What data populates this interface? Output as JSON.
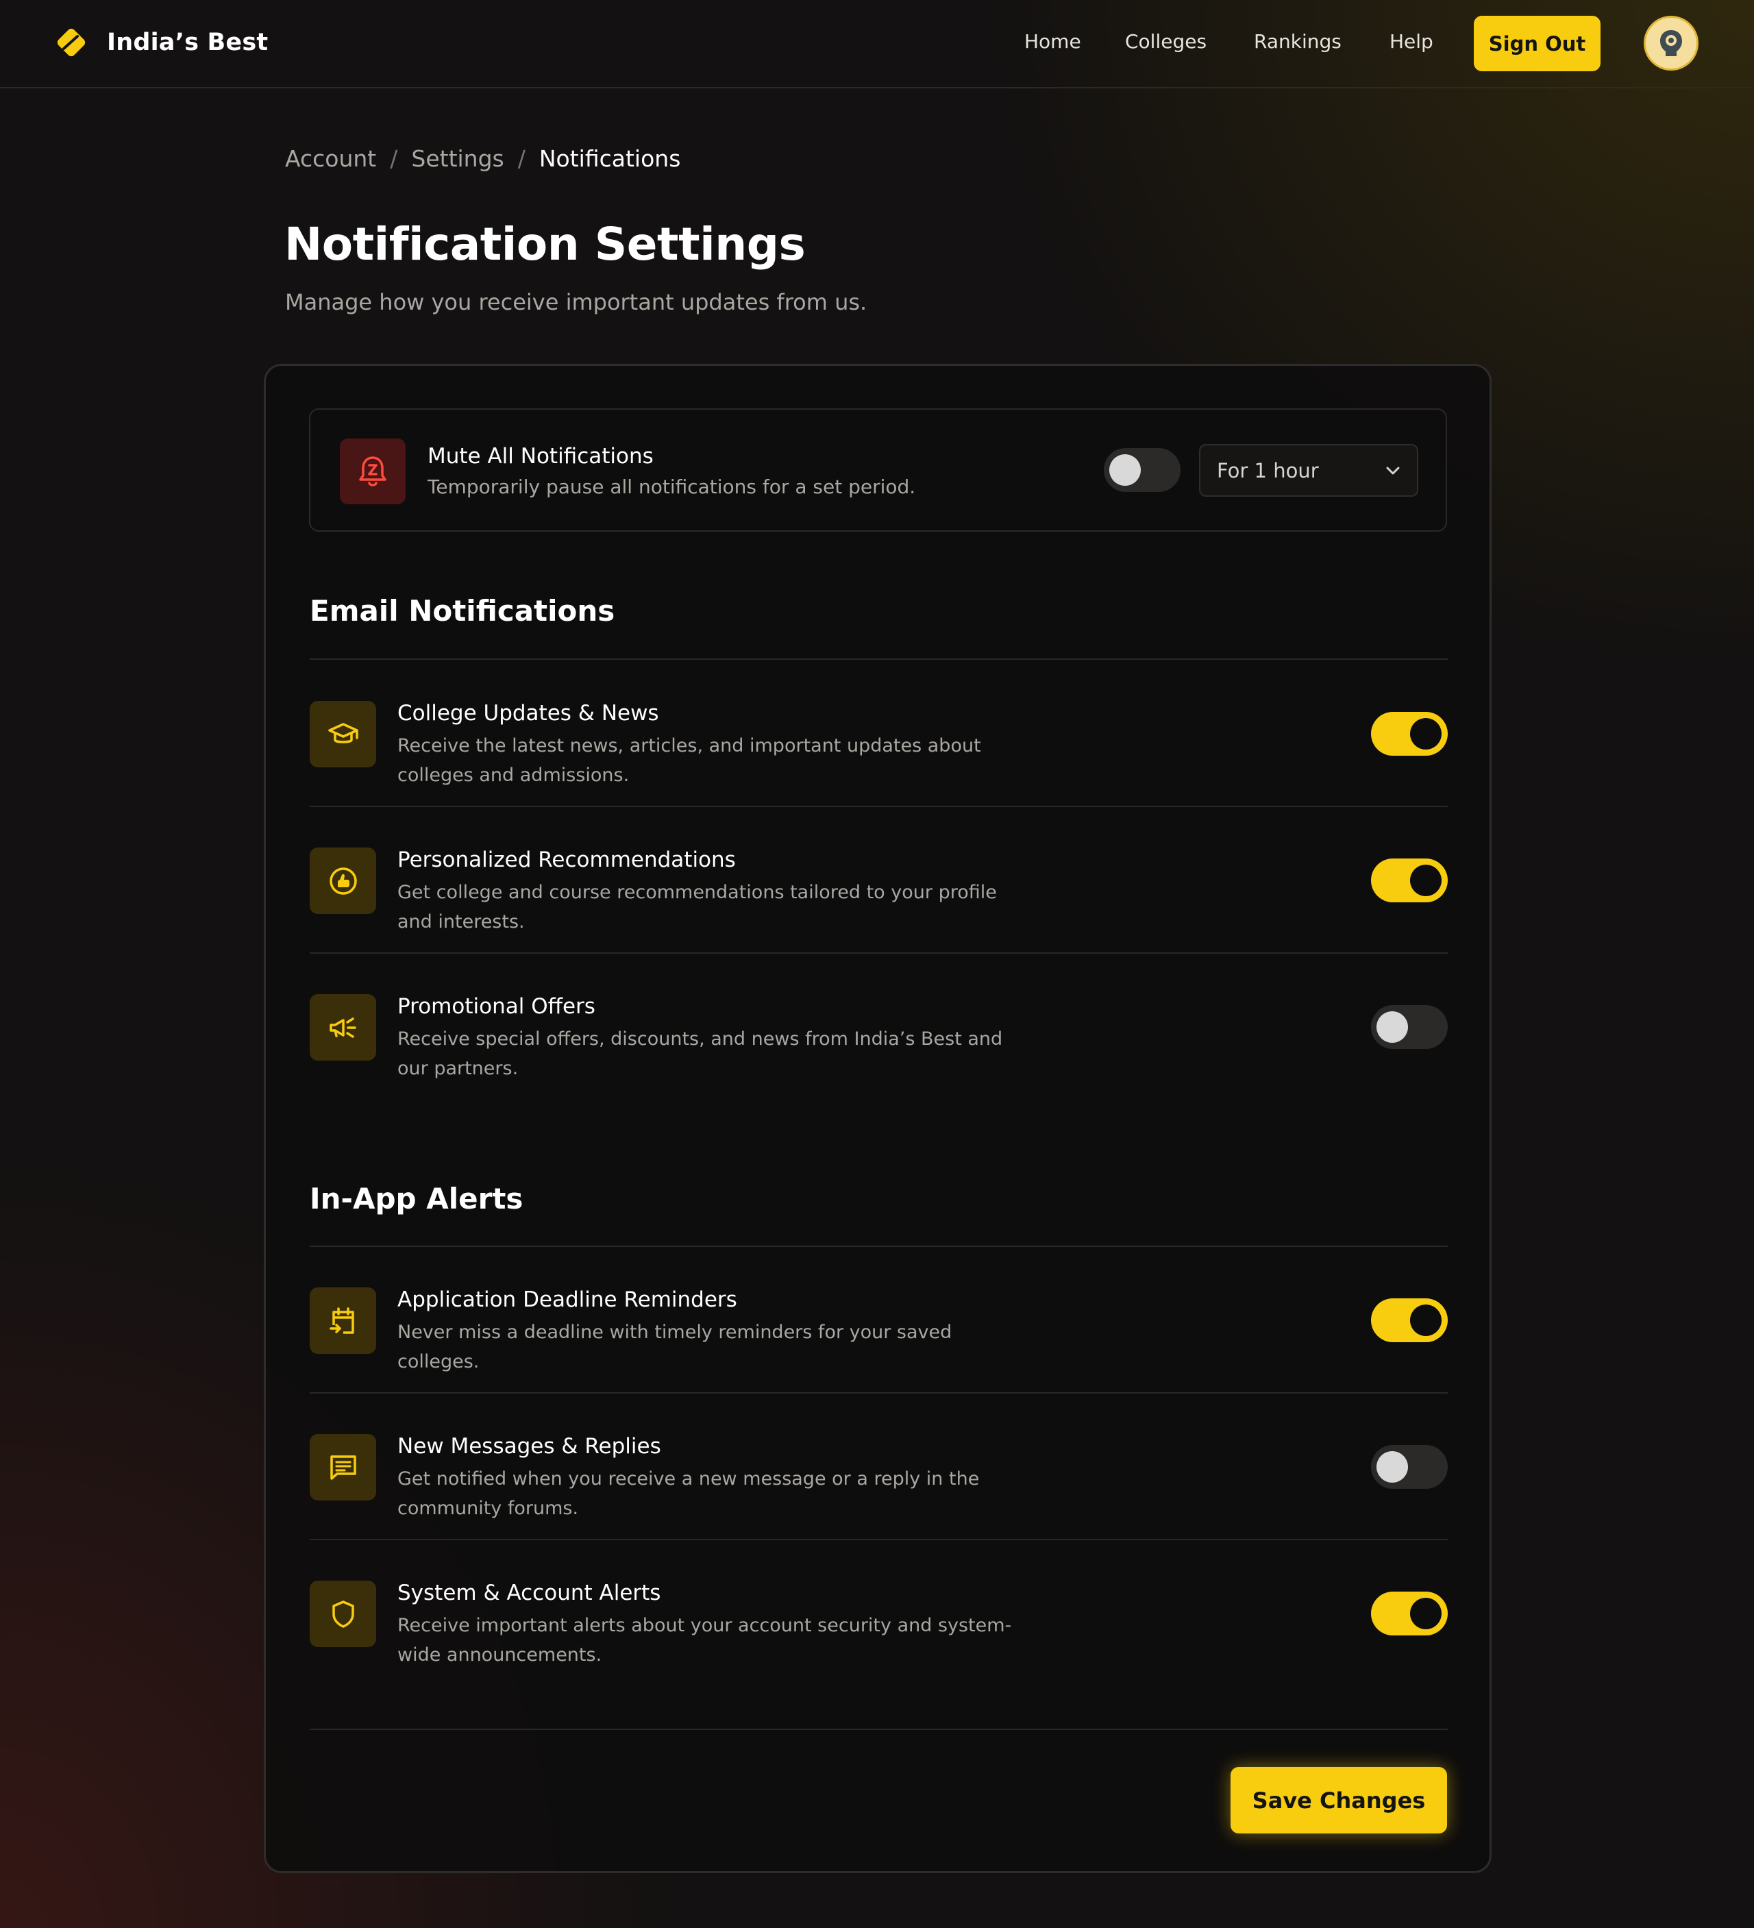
{
  "brand": {
    "name": "India’s Best",
    "logo_icon": "diamond-logo-icon",
    "accent": "#f8cd10"
  },
  "nav": {
    "items": [
      "Home",
      "Colleges",
      "Rankings",
      "Help"
    ],
    "signout_label": "Sign Out",
    "avatar_icon": "user-avatar-icon"
  },
  "breadcrumb": [
    "Account",
    "Settings",
    "Notifications"
  ],
  "breadcrumb_sep": "/",
  "page": {
    "title": "Notification Settings",
    "subtitle": "Manage how you receive important updates from us."
  },
  "mute": {
    "icon": "bell-snooze-icon",
    "title": "Mute All Notifications",
    "description": "Temporarily pause all notifications for a set period.",
    "enabled": false,
    "duration": "For 1 hour"
  },
  "sections": [
    {
      "title": "Email Notifications",
      "items": [
        {
          "icon": "graduation-cap-icon",
          "title": "College Updates & News",
          "description": "Receive the latest news, articles, and important updates about colleges and admissions.",
          "enabled": true
        },
        {
          "icon": "thumbs-up-icon",
          "title": "Personalized Recommendations",
          "description": "Get college and course recommendations tailored to your profile and interests.",
          "enabled": true
        },
        {
          "icon": "megaphone-icon",
          "title": "Promotional Offers",
          "description": "Receive special offers, discounts, and news from India’s Best and our partners.",
          "enabled": false
        }
      ]
    },
    {
      "title": "In-App Alerts",
      "items": [
        {
          "icon": "calendar-deadline-icon",
          "title": "Application Deadline Reminders",
          "description": "Never miss a deadline with timely reminders for your saved colleges.",
          "enabled": true
        },
        {
          "icon": "message-icon",
          "title": "New Messages & Replies",
          "description": "Get notified when you receive a new message or a reply in the community forums.",
          "enabled": false
        },
        {
          "icon": "shield-icon",
          "title": "System & Account Alerts",
          "description": "Receive important alerts about your account security and system-wide announcements.",
          "enabled": true
        }
      ]
    }
  ],
  "save_label": "Save Changes"
}
